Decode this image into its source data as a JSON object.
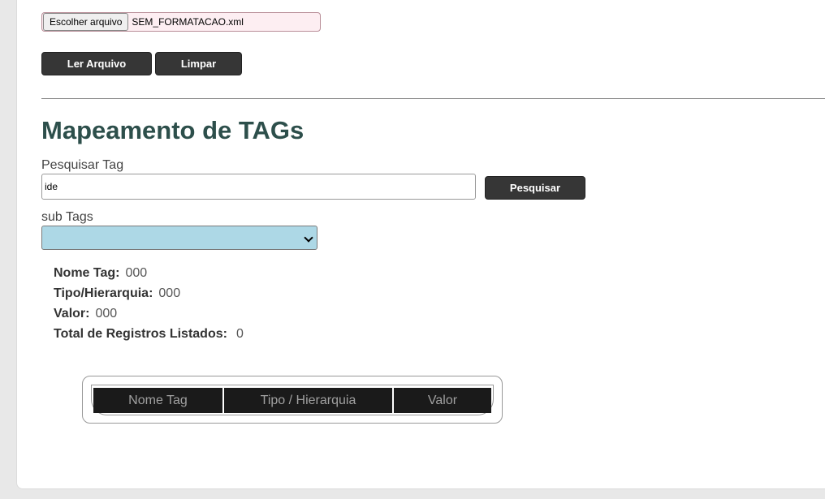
{
  "file": {
    "choose_label": "Escolher arquivo",
    "file_name": "SEM_FORMATACAO.xml"
  },
  "buttons": {
    "read": "Ler Arquivo",
    "clear": "Limpar",
    "search": "Pesquisar"
  },
  "title": "Mapeamento de TAGs",
  "search": {
    "label": "Pesquisar Tag",
    "value": "ide"
  },
  "subtags": {
    "label": "sub Tags",
    "selected": ""
  },
  "info": {
    "name_label": "Nome Tag:",
    "name_value": "000",
    "type_label": "Tipo/Hierarquia:",
    "type_value": "000",
    "value_label": "Valor:",
    "value_value": "000",
    "total_label": "Total de Registros Listados:",
    "total_value": "0"
  },
  "table": {
    "headers": [
      "Nome Tag",
      "Tipo / Hierarquia",
      "Valor"
    ]
  }
}
